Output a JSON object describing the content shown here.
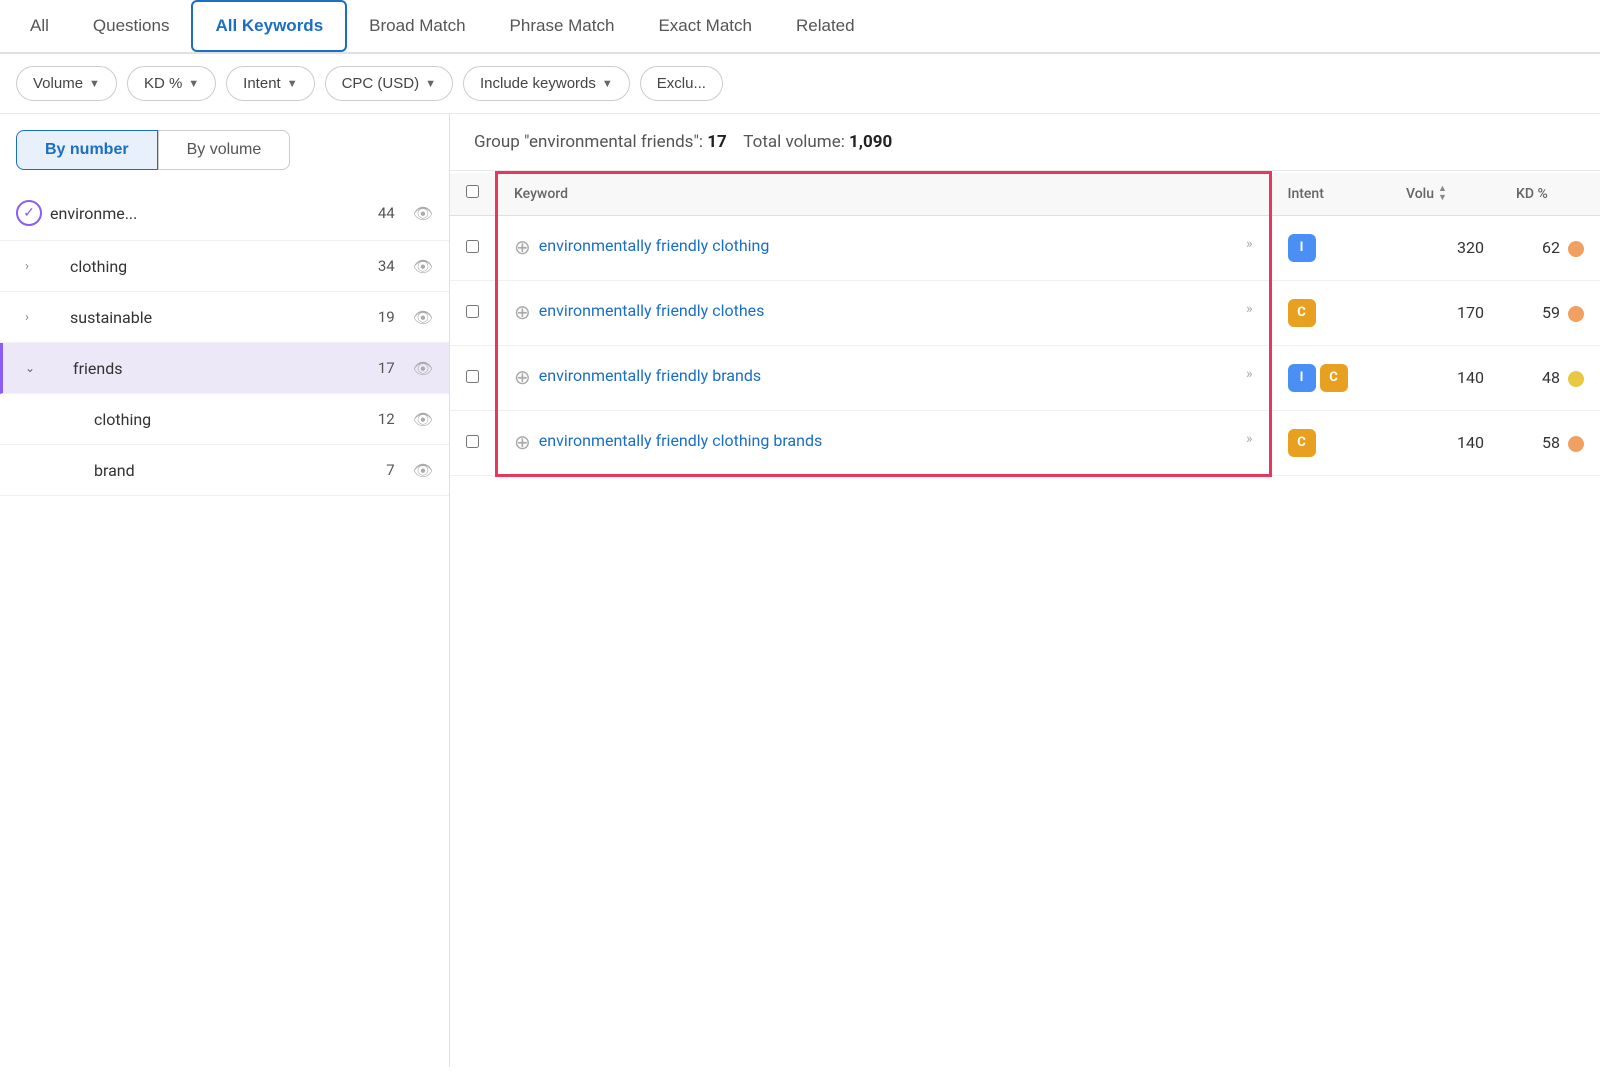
{
  "tabs": [
    {
      "label": "All",
      "active": false
    },
    {
      "label": "Questions",
      "active": false
    },
    {
      "label": "All Keywords",
      "active": true
    },
    {
      "label": "Broad Match",
      "active": false
    },
    {
      "label": "Phrase Match",
      "active": false
    },
    {
      "label": "Exact Match",
      "active": false
    },
    {
      "label": "Related",
      "active": false
    }
  ],
  "filters": [
    {
      "label": "Volume",
      "id": "volume"
    },
    {
      "label": "KD %",
      "id": "kd"
    },
    {
      "label": "Intent",
      "id": "intent"
    },
    {
      "label": "CPC (USD)",
      "id": "cpc"
    },
    {
      "label": "Include keywords",
      "id": "include"
    },
    {
      "label": "Exclu...",
      "id": "exclude"
    }
  ],
  "sort_buttons": [
    {
      "label": "By number",
      "active": true
    },
    {
      "label": "By volume",
      "active": false
    }
  ],
  "sidebar_items": [
    {
      "id": "environme",
      "label": "environme...",
      "count": 44,
      "indent": 0,
      "expanded": true,
      "icon": "chevron-down-circle"
    },
    {
      "id": "clothing",
      "label": "clothing",
      "count": 34,
      "indent": 1,
      "expanded": false,
      "icon": "chevron-right"
    },
    {
      "id": "sustainable",
      "label": "sustainable",
      "count": 19,
      "indent": 1,
      "expanded": false,
      "icon": "chevron-right"
    },
    {
      "id": "friends",
      "label": "friends",
      "count": 17,
      "indent": 1,
      "expanded": true,
      "selected": true,
      "icon": "chevron-down"
    },
    {
      "id": "clothing2",
      "label": "clothing",
      "count": 12,
      "indent": 2,
      "icon": "none"
    },
    {
      "id": "brand",
      "label": "brand",
      "count": 7,
      "indent": 2,
      "icon": "none"
    }
  ],
  "group_info": {
    "label": "Group \"environmental friends\":",
    "count": "17",
    "volume_label": "Total volume:",
    "volume": "1,090"
  },
  "table": {
    "columns": [
      {
        "id": "check",
        "label": ""
      },
      {
        "id": "keyword",
        "label": "Keyword"
      },
      {
        "id": "intent",
        "label": "Intent"
      },
      {
        "id": "volume",
        "label": "Volu"
      },
      {
        "id": "kd",
        "label": "KD %"
      }
    ],
    "rows": [
      {
        "keyword": "environmentally friendly clothing",
        "intent_badges": [
          "I"
        ],
        "volume": "320",
        "kd": "62",
        "kd_color": "orange"
      },
      {
        "keyword": "environmentally friendly clothes",
        "intent_badges": [
          "C"
        ],
        "volume": "170",
        "kd": "59",
        "kd_color": "orange"
      },
      {
        "keyword": "environmentally friendly brands",
        "intent_badges": [
          "I",
          "C"
        ],
        "volume": "140",
        "kd": "48",
        "kd_color": "yellow"
      },
      {
        "keyword": "environmentally friendly clothing brands",
        "intent_badges": [
          "C"
        ],
        "volume": "140",
        "kd": "58",
        "kd_color": "orange"
      }
    ]
  }
}
